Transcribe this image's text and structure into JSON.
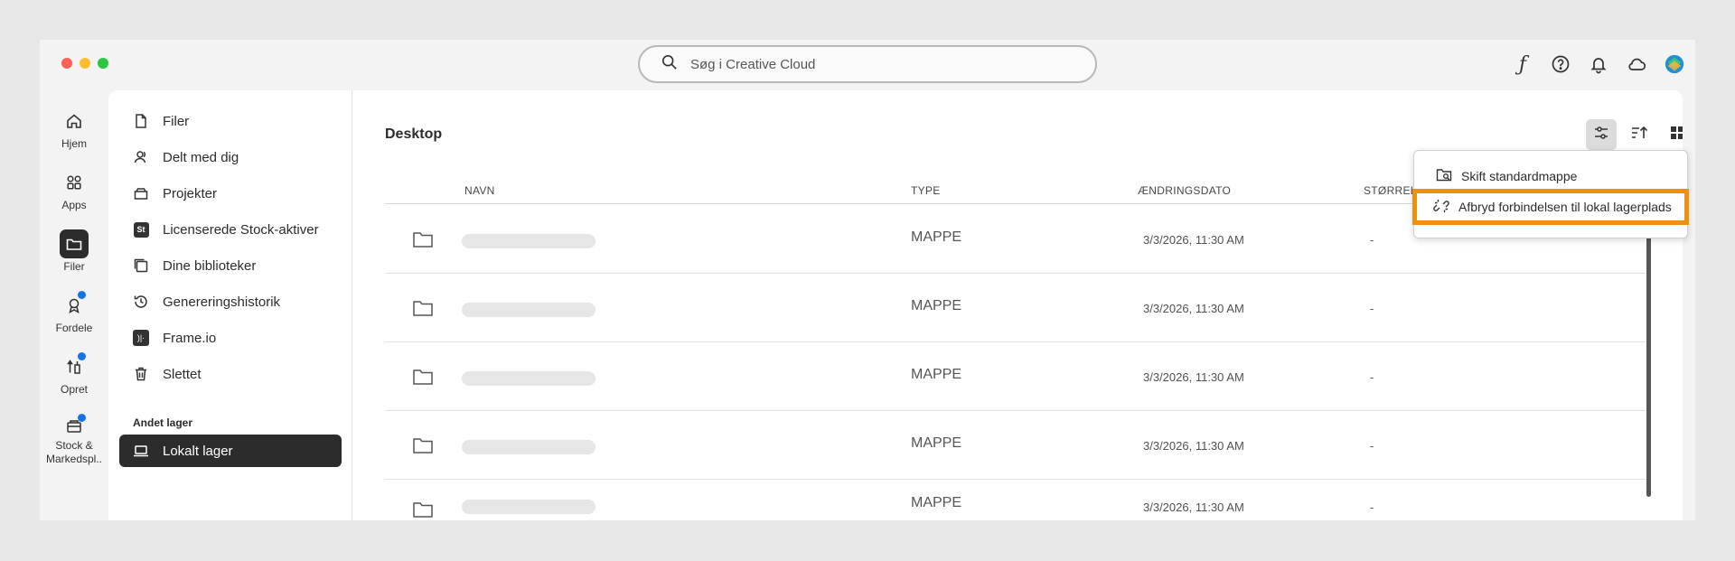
{
  "search": {
    "placeholder": "Søg i Creative Cloud"
  },
  "top_icons": [
    "font-icon",
    "help-icon",
    "notification-bell-icon",
    "cloud-icon",
    "avatar"
  ],
  "rail": [
    {
      "label": "Hjem",
      "icon": "home-icon"
    },
    {
      "label": "Apps",
      "icon": "apps-icon"
    },
    {
      "label": "Filer",
      "icon": "folder-icon",
      "active": true
    },
    {
      "label": "Fordele",
      "icon": "benefits-icon",
      "badge": true
    },
    {
      "label": "Opret",
      "icon": "create-icon",
      "badge": true
    },
    {
      "label": "Stock & Markedspl..",
      "icon": "stock-icon",
      "badge": true
    }
  ],
  "nav": {
    "items": [
      {
        "label": "Filer",
        "icon": "file-icon"
      },
      {
        "label": "Delt med dig",
        "icon": "shared-icon"
      },
      {
        "label": "Projekter",
        "icon": "projects-icon"
      },
      {
        "label": "Licenserede Stock-aktiver",
        "icon": "stock-st-icon"
      },
      {
        "label": "Dine biblioteker",
        "icon": "libraries-icon"
      },
      {
        "label": "Genereringshistorik",
        "icon": "history-icon"
      },
      {
        "label": "Frame.io",
        "icon": "frameio-icon"
      },
      {
        "label": "Slettet",
        "icon": "trash-icon"
      }
    ],
    "section_label": "Andet lager",
    "local_storage": {
      "label": "Lokalt lager",
      "icon": "laptop-icon",
      "active": true
    }
  },
  "main": {
    "title": "Desktop",
    "columns": {
      "name": "NAVN",
      "type": "TYPE",
      "modified": "ÆNDRINGSDATO",
      "size": "STØRREL"
    },
    "rows": [
      {
        "type": "MAPPE",
        "date": "3/3/2026, 11:30 AM",
        "size": "-"
      },
      {
        "type": "MAPPE",
        "date": "3/3/2026, 11:30 AM",
        "size": "-"
      },
      {
        "type": "MAPPE",
        "date": "3/3/2026, 11:30 AM",
        "size": "-"
      },
      {
        "type": "MAPPE",
        "date": "3/3/2026, 11:30 AM",
        "size": "-"
      },
      {
        "type": "MAPPE",
        "date": "3/3/2026, 11:30 AM",
        "size": "-"
      }
    ]
  },
  "menu": {
    "change_default": "Skift standardmappe",
    "disconnect": "Afbryd forbindelsen til lokal lagerplads"
  },
  "colors": {
    "highlight": "#f0900e",
    "badge": "#1473e6",
    "active": "#2c2c2c"
  }
}
